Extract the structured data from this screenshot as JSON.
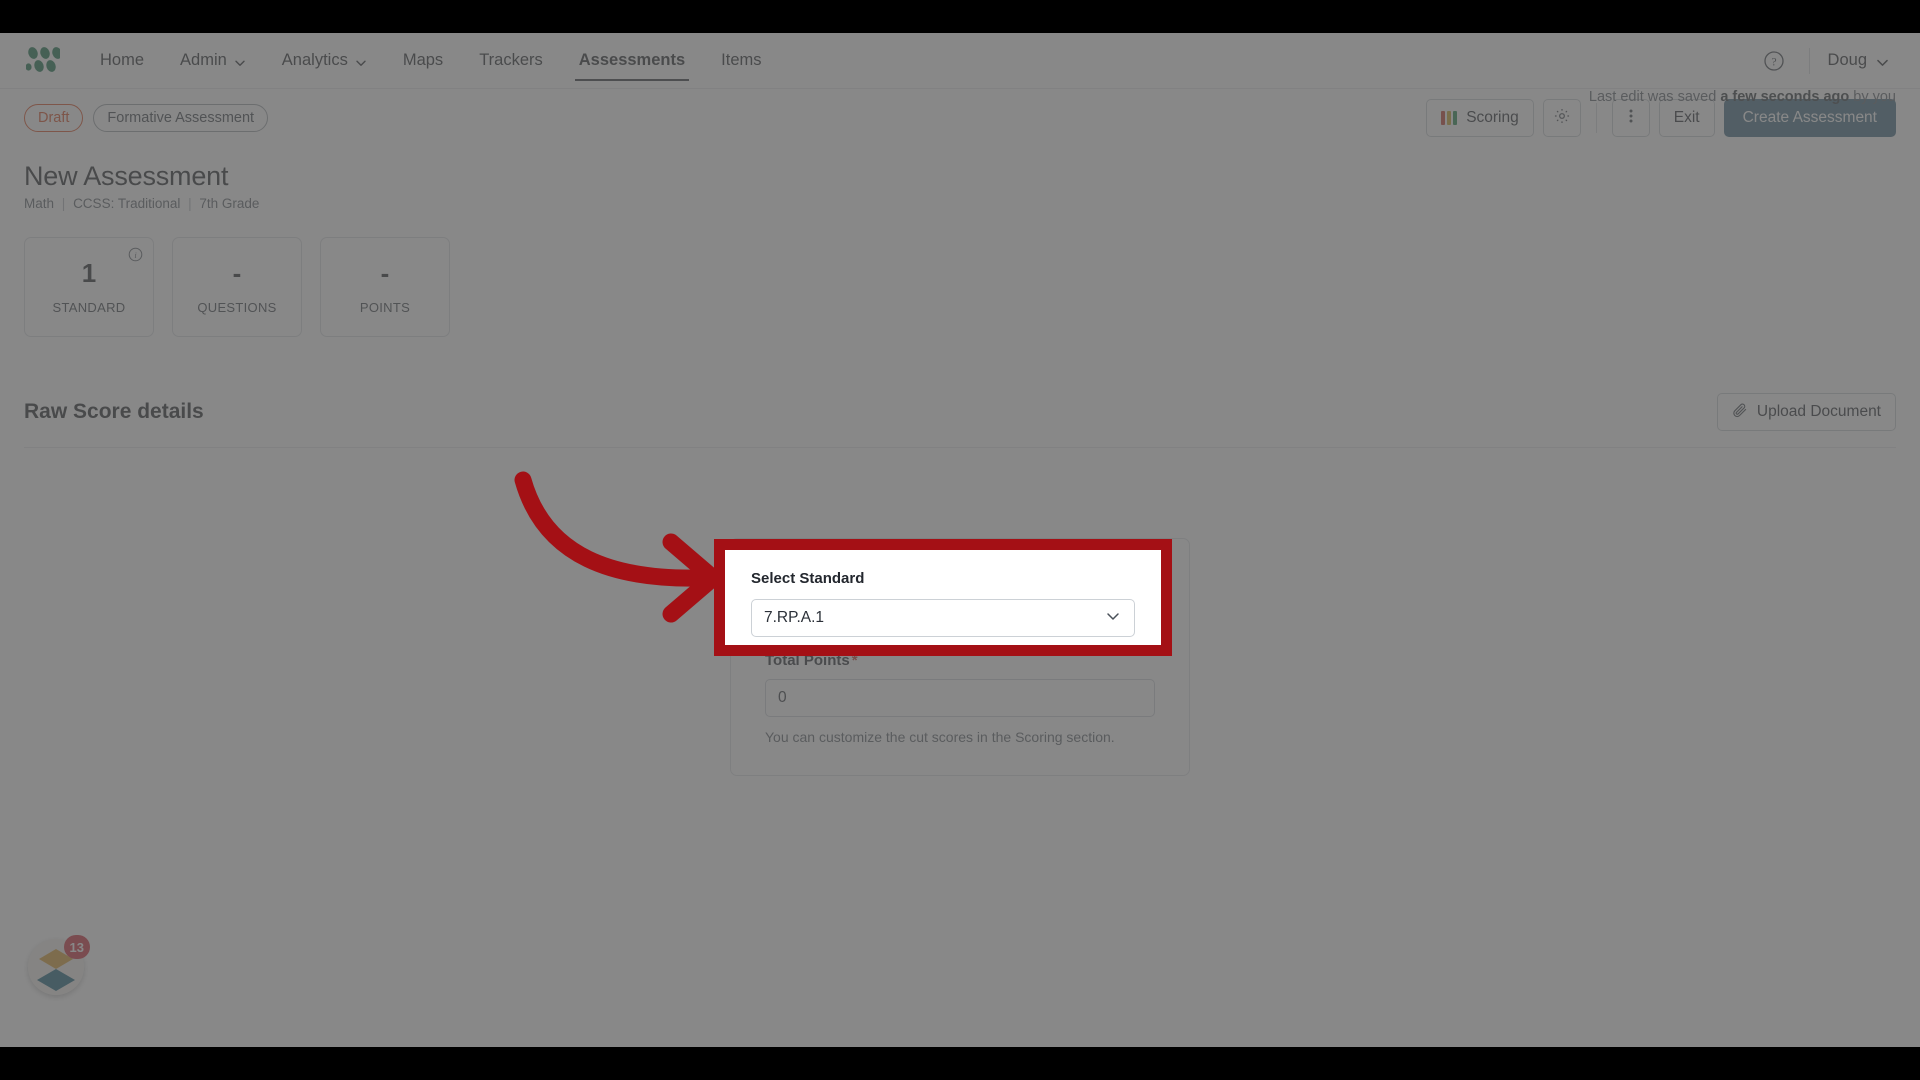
{
  "nav": {
    "logo_name": "product-logo",
    "items": [
      {
        "label": "Home",
        "has_caret": false,
        "active": false
      },
      {
        "label": "Admin",
        "has_caret": true,
        "active": false
      },
      {
        "label": "Analytics",
        "has_caret": true,
        "active": false
      },
      {
        "label": "Maps",
        "has_caret": false,
        "active": false
      },
      {
        "label": "Trackers",
        "has_caret": false,
        "active": false
      },
      {
        "label": "Assessments",
        "has_caret": false,
        "active": true
      },
      {
        "label": "Items",
        "has_caret": false,
        "active": false
      }
    ],
    "help_icon": "question-circle-icon",
    "user_name": "Doug",
    "user_caret_icon": "chevron-down-icon"
  },
  "actionbar": {
    "status_badge": "Draft",
    "type_badge": "Formative Assessment",
    "scoring_label": "Scoring",
    "scoring_icon": "score-bars-icon",
    "settings_icon": "gear-icon",
    "more_icon": "vertical-dots-icon",
    "exit_label": "Exit",
    "create_label": "Create Assessment",
    "saved_prefix": "Last edit was saved ",
    "saved_emphasis": "a few seconds ago",
    "saved_suffix": " by you",
    "accent_primary": "#3f6a80",
    "accent_draft": "#d8491e"
  },
  "header": {
    "title": "New Assessment",
    "meta_subject": "Math",
    "meta_standard_set": "CCSS: Traditional",
    "meta_grade": "7th Grade"
  },
  "stats": [
    {
      "value": "1",
      "label": "STANDARD",
      "info_icon": "info-circle-icon"
    },
    {
      "value": "-",
      "label": "QUESTIONS",
      "info_icon": ""
    },
    {
      "value": "-",
      "label": "POINTS",
      "info_icon": ""
    }
  ],
  "section": {
    "heading": "Raw Score details",
    "upload_label": "Upload Document",
    "upload_icon": "paperclip-icon"
  },
  "form": {
    "standard_label": "Select Standard",
    "standard_value": "7.RP.A.1",
    "standard_caret_icon": "chevron-down-icon",
    "points_label": "Total Points",
    "points_required_mark": "*",
    "points_value": "0",
    "help_text": "You can customize the cut scores in the Scoring section."
  },
  "fab": {
    "name": "help-widget",
    "badge_count": "13"
  },
  "annotation": {
    "highlight_color": "#A41015",
    "arrow_icon": "curved-arrow-icon"
  }
}
